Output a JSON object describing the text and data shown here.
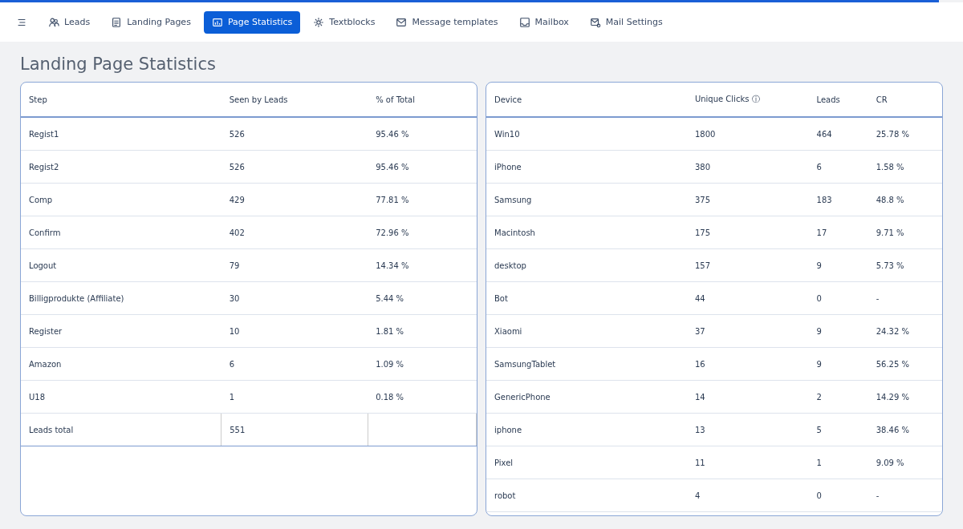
{
  "nav": {
    "tabs": [
      {
        "label": "Leads",
        "selected": false
      },
      {
        "label": "Landing Pages",
        "selected": false
      },
      {
        "label": "Page Statistics",
        "selected": true
      },
      {
        "label": "Textblocks",
        "selected": false
      },
      {
        "label": "Message templates",
        "selected": false
      },
      {
        "label": "Mailbox",
        "selected": false
      },
      {
        "label": "Mail Settings",
        "selected": false
      }
    ]
  },
  "page_title": "Landing Page Statistics",
  "tables": [
    {
      "columns": [
        "Step",
        "Seen by Leads",
        "% of Total"
      ],
      "rows": [
        [
          "Regist1",
          "526",
          "95.46 %"
        ],
        [
          "Regist2",
          "526",
          "95.46 %"
        ],
        [
          "Comp",
          "429",
          "77.81 %"
        ],
        [
          "Confirm",
          "402",
          "72.96 %"
        ],
        [
          "Logout",
          "79",
          "14.34 %"
        ],
        [
          "Billigprodukte (Affiliate)",
          "30",
          "5.44 %"
        ],
        [
          "Register",
          "10",
          "1.81 %"
        ],
        [
          "Amazon",
          "6",
          "1.09 %"
        ],
        [
          "U18",
          "1",
          "0.18 %"
        ]
      ],
      "footer": [
        "Leads total",
        "551"
      ]
    },
    {
      "columns": [
        "Device",
        "Unique Clicks ⓘ",
        "Leads",
        "CR"
      ],
      "rows": [
        [
          "Win10",
          "1800",
          "464",
          "25.78 %"
        ],
        [
          "iPhone",
          "380",
          "6",
          "1.58 %"
        ],
        [
          "Samsung",
          "375",
          "183",
          "48.8 %"
        ],
        [
          "Macintosh",
          "175",
          "17",
          "9.71 %"
        ],
        [
          "desktop",
          "157",
          "9",
          "5.73 %"
        ],
        [
          "Bot",
          "44",
          "0",
          "-"
        ],
        [
          "Xiaomi",
          "37",
          "9",
          "24.32 %"
        ],
        [
          "SamsungTablet",
          "16",
          "9",
          "56.25 %"
        ],
        [
          "GenericPhone",
          "14",
          "2",
          "14.29 %"
        ],
        [
          "iphone",
          "13",
          "5",
          "38.46 %"
        ],
        [
          "Pixel",
          "11",
          "1",
          "9.09 %"
        ],
        [
          "robot",
          "4",
          "0",
          "-"
        ]
      ]
    }
  ]
}
